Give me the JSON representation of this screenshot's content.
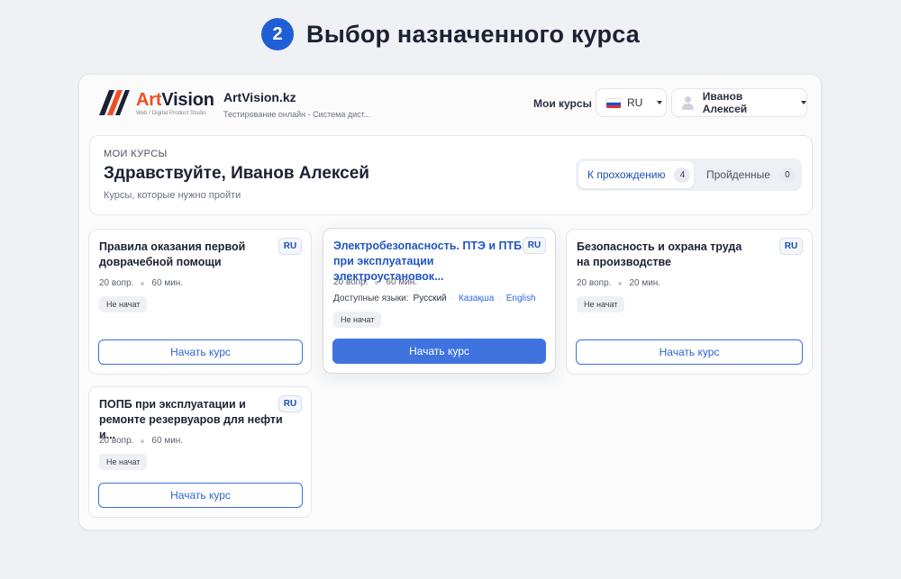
{
  "step": {
    "number": "2",
    "title": "Выбор назначенного курса"
  },
  "brand": {
    "logo_name_part1": "Art",
    "logo_name_part2": "Vision",
    "logo_subtitle": "Web / Digital Product Studio",
    "site_name": "ArtVision.kz",
    "site_description": "Тестирование онлайн - Система дист...",
    "accent_color": "#f04e23"
  },
  "nav": {
    "my_courses": "Мои курсы",
    "language": "RU",
    "user_name": "Иванов Алексей"
  },
  "welcome": {
    "kicker": "МОИ КУРСЫ",
    "title": "Здравствуйте, Иванов Алексей",
    "subtitle": "Курсы, которые нужно пройти",
    "tabs": [
      {
        "label": "К прохождению",
        "count": "4",
        "active": true
      },
      {
        "label": "Пройденные",
        "count": "0",
        "active": false
      }
    ]
  },
  "courses": [
    {
      "title": "Правила оказания первой доврачебной помощи",
      "lang": "RU",
      "questions": "20 вопр.",
      "duration": "60 мин.",
      "status": "Не начат",
      "button": "Начать курс"
    },
    {
      "title": "Электробезопасность. ПТЭ и ПТБ при эксплуатации электроустановок...",
      "lang": "RU",
      "questions": "20 вопр.",
      "duration": "60 мин.",
      "available_languages_label": "Доступные языки:",
      "available_languages": [
        "Русский",
        "Казақша",
        "English"
      ],
      "status": "Не начат",
      "button": "Начать курс"
    },
    {
      "title": "Безопасность и охрана труда на производстве",
      "lang": "RU",
      "questions": "20 вопр.",
      "duration": "20 мин.",
      "status": "Не начат",
      "button": "Начать курс"
    },
    {
      "title": "ПОПБ при эксплуатации и ремонте резервуаров для нефти и...",
      "lang": "RU",
      "questions": "20 вопр.",
      "duration": "60 мин.",
      "status": "Не начат",
      "button": "Начать курс"
    }
  ],
  "colors": {
    "primary": "#3f74e0",
    "step_badge": "#1f5fd6",
    "link": "#2f6ad9"
  }
}
